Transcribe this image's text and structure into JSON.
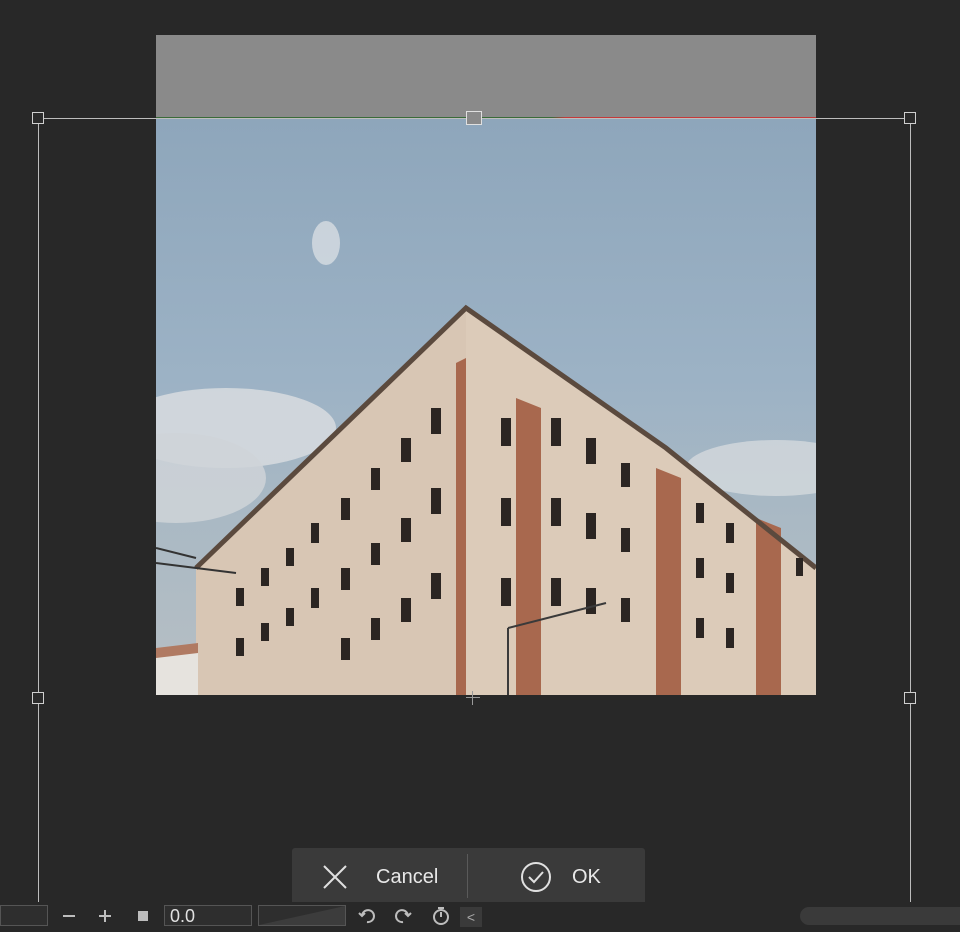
{
  "dialog": {
    "cancel_label": "Cancel",
    "ok_label": "OK"
  },
  "toolbar": {
    "angle_value": "0.0",
    "collapse_glyph": "<"
  },
  "icons": {
    "cancel": "close-x-icon",
    "ok": "check-circle-icon",
    "zoom_out": "minus-icon",
    "zoom_in": "plus-icon",
    "stop": "square-icon",
    "undo": "undo-icon",
    "redo": "redo-icon",
    "reset": "reset-timer-icon"
  },
  "colors": {
    "background": "#282828",
    "crop_band": "#8a8a8a",
    "dialog_bg": "#3a3a3a",
    "edge_green": "#3a6b3a",
    "edge_red": "#c43a3a"
  }
}
